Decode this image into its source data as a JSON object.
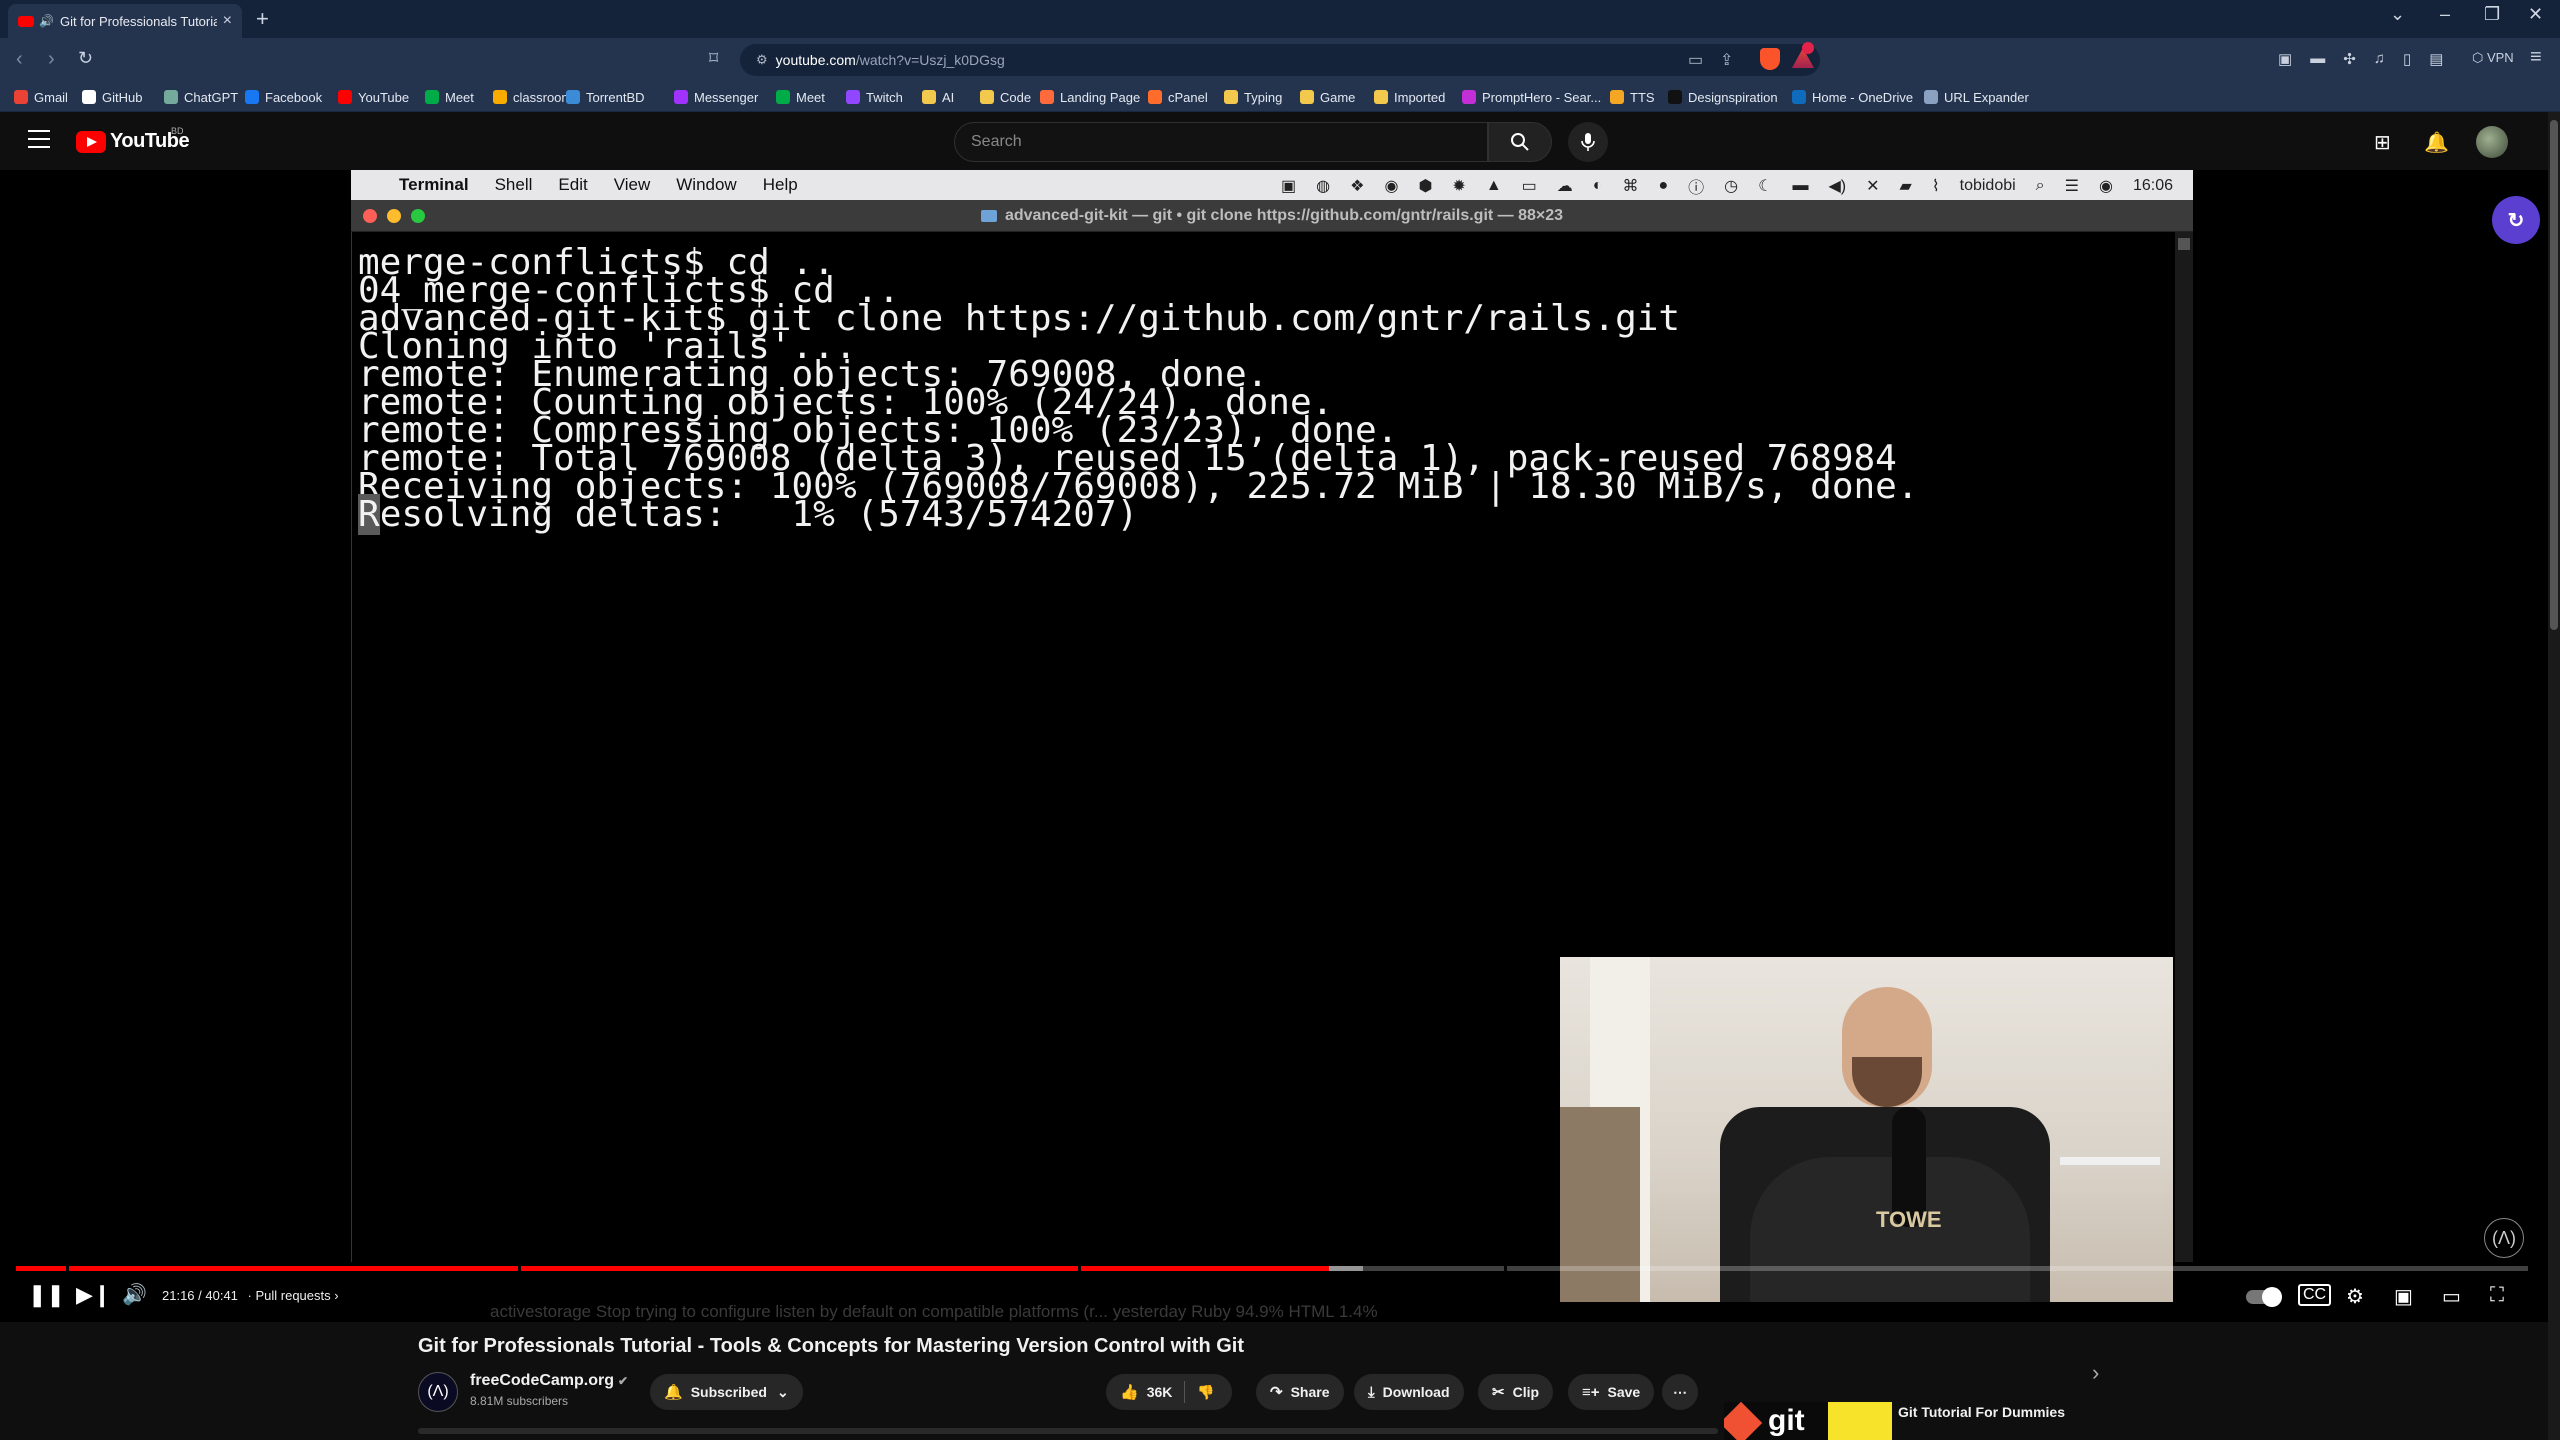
{
  "browser": {
    "tab_title": "Git for Professionals Tutorial",
    "url_host": "youtube.com",
    "url_path": "/watch?v=Uszj_k0DGsg",
    "vpn_label": "VPN",
    "bookmarks": [
      {
        "label": "Gmail",
        "color": "#ea4335"
      },
      {
        "label": "GitHub",
        "color": "#ffffff"
      },
      {
        "label": "ChatGPT",
        "color": "#74aa9c"
      },
      {
        "label": "Facebook",
        "color": "#1877f2"
      },
      {
        "label": "YouTube",
        "color": "#ff0000"
      },
      {
        "label": "Meet",
        "color": "#00ac47"
      },
      {
        "label": "classroom",
        "color": "#f9ab00"
      },
      {
        "label": "TorrentBD",
        "color": "#3b8bd6"
      },
      {
        "label": "Messenger",
        "color": "#a033ff"
      },
      {
        "label": "Meet",
        "color": "#00ac47"
      },
      {
        "label": "Twitch",
        "color": "#9146ff"
      },
      {
        "label": "AI",
        "color": "#f2c94c"
      },
      {
        "label": "Code",
        "color": "#f2c94c"
      },
      {
        "label": "Landing Page",
        "color": "#ff6a3d"
      },
      {
        "label": "cPanel",
        "color": "#ff6c2c"
      },
      {
        "label": "Typing",
        "color": "#f2c94c"
      },
      {
        "label": "Game",
        "color": "#f2c94c"
      },
      {
        "label": "Imported",
        "color": "#f2c94c"
      },
      {
        "label": "PromptHero - Sear...",
        "color": "#c22fd6"
      },
      {
        "label": "TTS",
        "color": "#f5a623"
      },
      {
        "label": "Designspiration",
        "color": "#111111"
      },
      {
        "label": "Home - OneDrive",
        "color": "#0f6cbd"
      },
      {
        "label": "URL Expander",
        "color": "#8aa1c1"
      }
    ]
  },
  "youtube": {
    "logo_text": "YouTube",
    "country_code": "BD",
    "search_placeholder": "Search",
    "video_title": "Git for Professionals Tutorial - Tools & Concepts for Mastering Version Control with Git",
    "channel_name": "freeCodeCamp.org",
    "channel_subs": "8.81M subscribers",
    "subscribed_label": "Subscribed",
    "likes": "36K",
    "share_label": "Share",
    "download_label": "Download",
    "clip_label": "Clip",
    "save_label": "Save",
    "related_title": "Git Tutorial For Dummies",
    "related_thumb_text": "git"
  },
  "player": {
    "time_current": "21:16",
    "time_total": "40:41",
    "time_text": "21:16 / 40:41",
    "chapter": "· Pull requests",
    "progress": 0.5228,
    "buffered": 0.5363,
    "behind_text": "activestorage      Stop trying to configure listen by default on compatible platforms (r...      yesterday       Ruby 94.9%     HTML 1.4%"
  },
  "video_frame": {
    "mac_menu": {
      "app": "Terminal",
      "items": [
        "Shell",
        "Edit",
        "View",
        "Window",
        "Help"
      ],
      "user": "tobidobi",
      "clock": "16:06"
    },
    "terminal_title": "advanced-git-kit — git • git clone https://github.com/gntr/rails.git — 88×23",
    "lines": [
      "merge-conflicts$ cd ..",
      "04_merge-conflicts$ cd ..",
      "advanced-git-kit$ git clone https://github.com/gntr/rails.git",
      "Cloning into 'rails'...",
      "remote: Enumerating objects: 769008, done.",
      "remote: Counting objects: 100% (24/24), done.",
      "remote: Compressing objects: 100% (23/23), done.",
      "remote: Total 769008 (delta 3), reused 15 (delta 1), pack-reused 768984",
      "Receiving objects: 100% (769008/769008), 225.72 MiB | 18.30 MiB/s, done.",
      "Resolving deltas:   1% (5743/574207)"
    ],
    "last_line_first_char": "R",
    "last_line_rest": "esolving deltas:   1% (5743/574207)",
    "shirt_text": "TOWE",
    "watermark": "(Λ)"
  },
  "colors": {
    "brand_red": "#ff0000",
    "browser_frame": "#24344f",
    "terminal_bg": "#000000",
    "mac_menubar": "#e7e7e9"
  }
}
